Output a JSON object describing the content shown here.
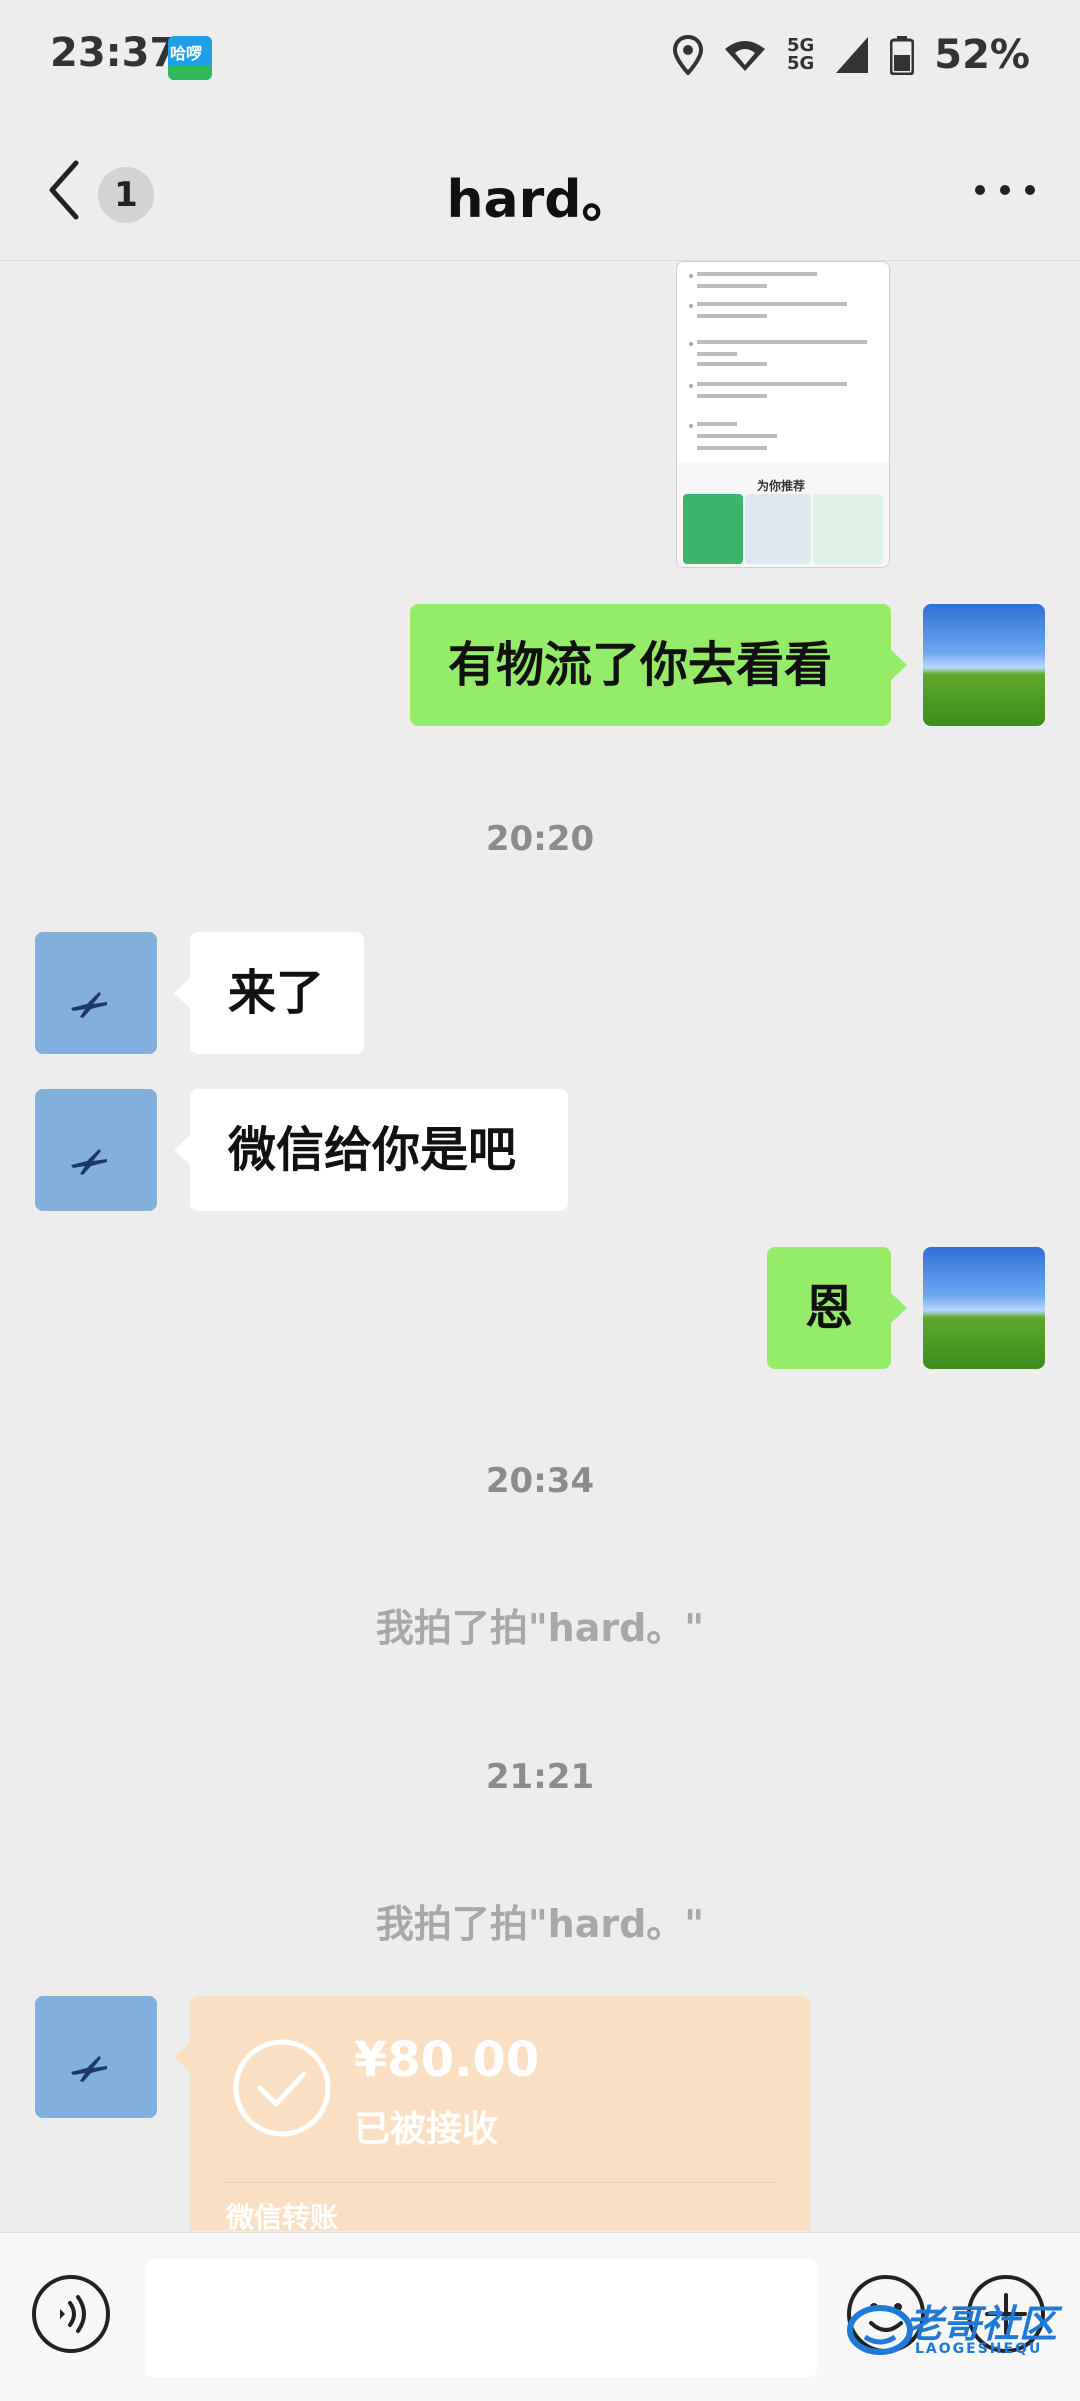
{
  "status_bar": {
    "time": "23:37",
    "app_badge": "哈啰",
    "network": "5G",
    "battery": "52%"
  },
  "header": {
    "unread_count": "1",
    "title": "hard。"
  },
  "messages": {
    "msg1": "有物流了你去看看",
    "ts1": "20:20",
    "msg2": "来了",
    "msg3": "微信给你是吧",
    "msg4": "恩",
    "ts2": "20:34",
    "sys1": "我拍了拍\"hard。\"",
    "ts3": "21:21",
    "sys2": "我拍了拍\"hard。\""
  },
  "shared_image": {
    "promo_title": "为你推荐"
  },
  "transfer": {
    "amount": "¥80.00",
    "status": "已被接收",
    "footer": "微信转账"
  },
  "watermark": {
    "title": "老哥社区",
    "subtitle": "LAOGESHEQU"
  },
  "colors": {
    "sent_bubble": "#95ec69",
    "transfer_card": "#fbdfc3",
    "background": "#ededed"
  }
}
